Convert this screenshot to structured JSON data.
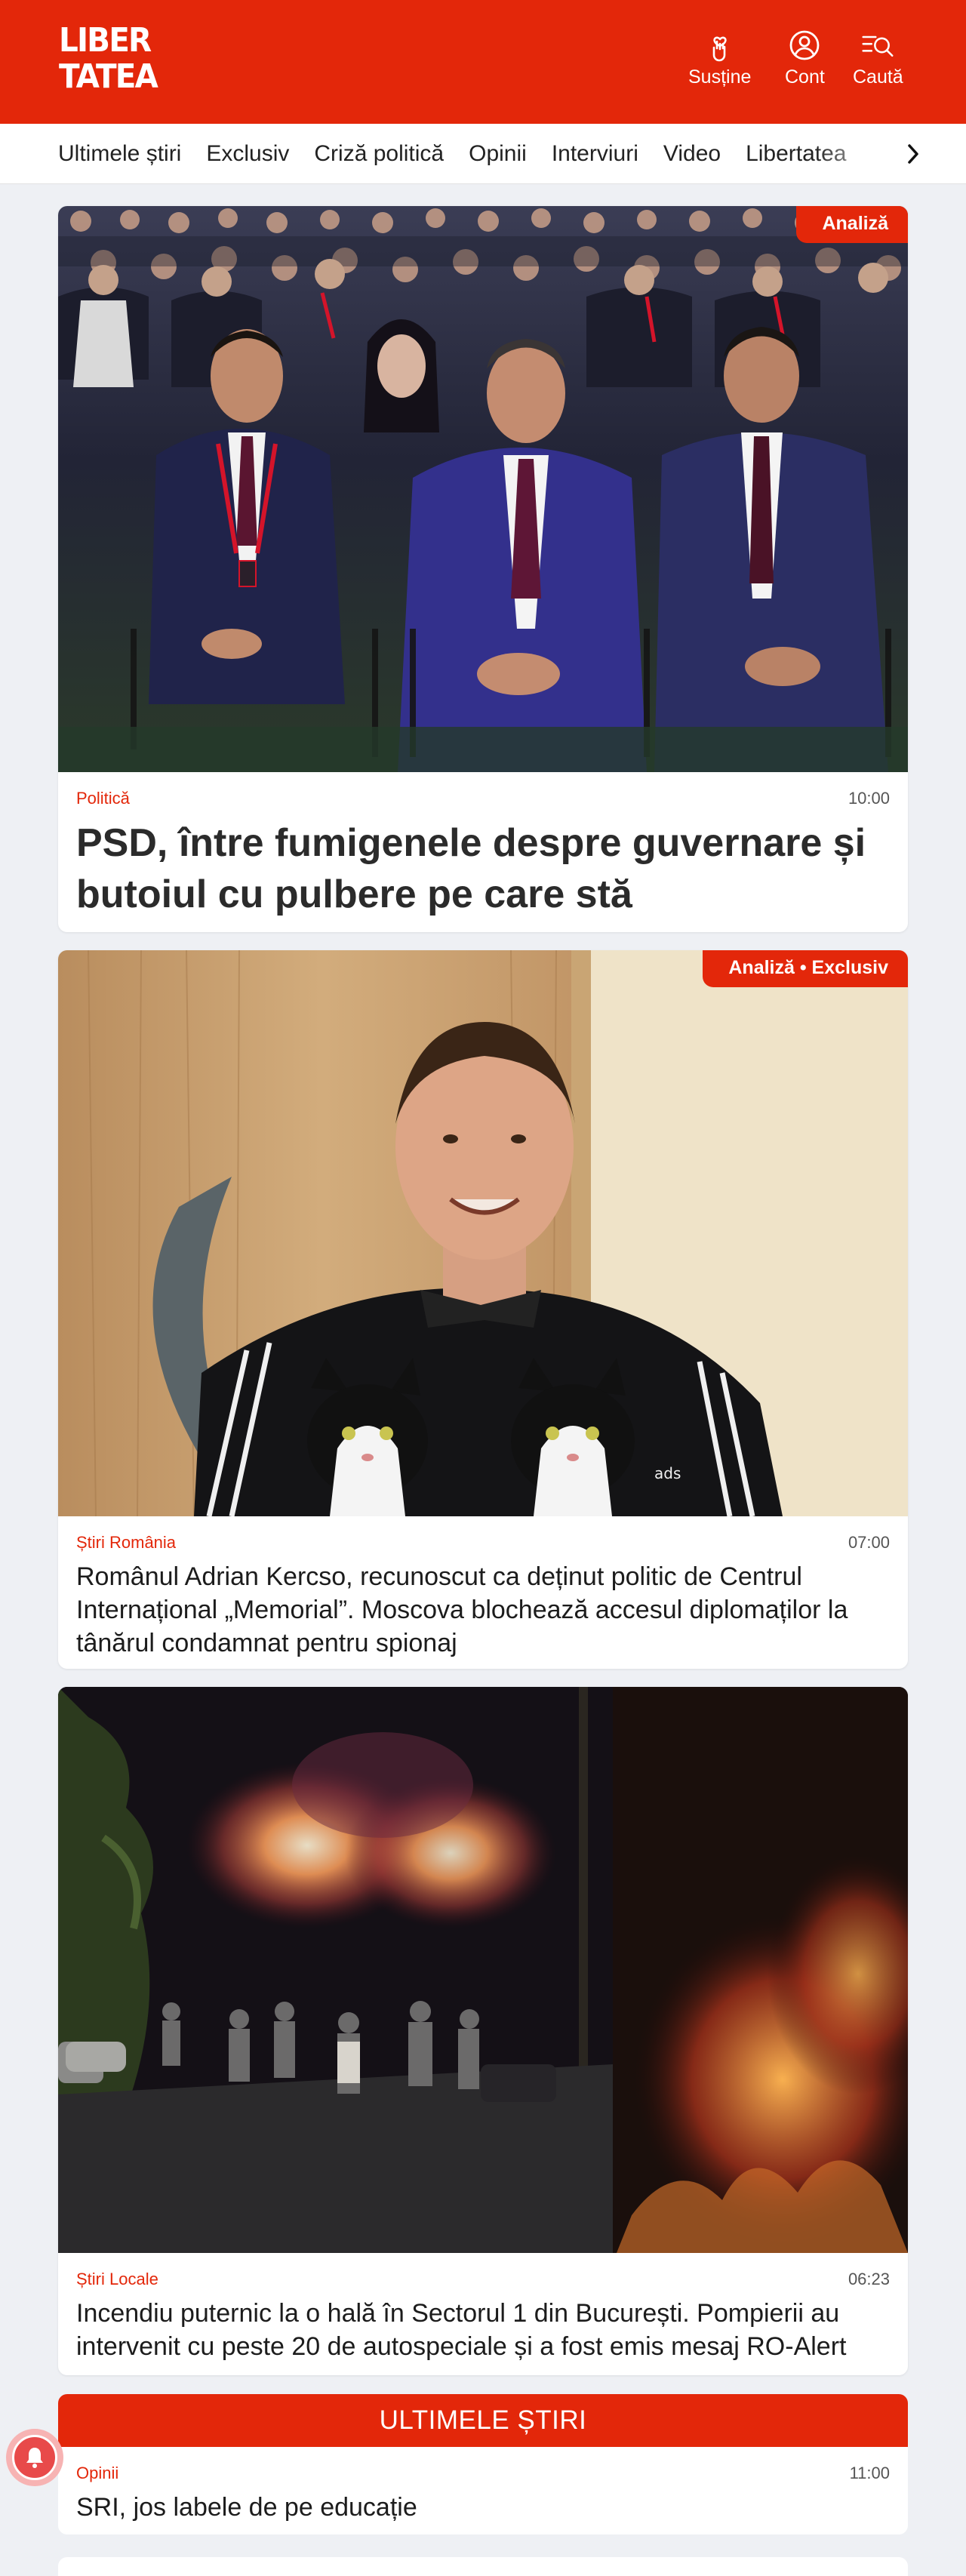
{
  "header": {
    "logo_line1": "LIBER",
    "logo_line2": "TATEA",
    "actions": [
      {
        "label": "Susține",
        "icon": "hand-heart-icon"
      },
      {
        "label": "Cont",
        "icon": "user-icon"
      },
      {
        "label": "Caută",
        "icon": "search-icon"
      }
    ],
    "brand_color": "#e3270a"
  },
  "nav": {
    "items": [
      "Ultimele știri",
      "Exclusiv",
      "Criză politică",
      "Opinii",
      "Interviuri",
      "Video",
      "Libertatea"
    ]
  },
  "articles": [
    {
      "badge": "Analiză",
      "category": "Politică",
      "time": "10:00",
      "title": "PSD, între fumigenele despre guvernare și butoiul cu pulbere pe care stă"
    },
    {
      "badge": "Analiză • Exclusiv",
      "category": "Știri România",
      "time": "07:00",
      "title": "Românul Adrian Kercso, recunoscut ca deținut politic de Centrul Internațional „Memorial”. Moscova blochează accesul diplomaților la tânărul condamnat pentru spionaj"
    },
    {
      "category": "Știri Locale",
      "time": "06:23",
      "title": "Incendiu puternic la o hală în Sectorul 1 din București. Pompierii au intervenit cu peste 20 de autospeciale și a fost emis mesaj RO-Alert"
    }
  ],
  "latest": {
    "heading": "ULTIMELE ȘTIRI",
    "items": [
      {
        "category": "Opinii",
        "time": "11:00",
        "title": "SRI, jos labele de pe educație"
      }
    ]
  }
}
